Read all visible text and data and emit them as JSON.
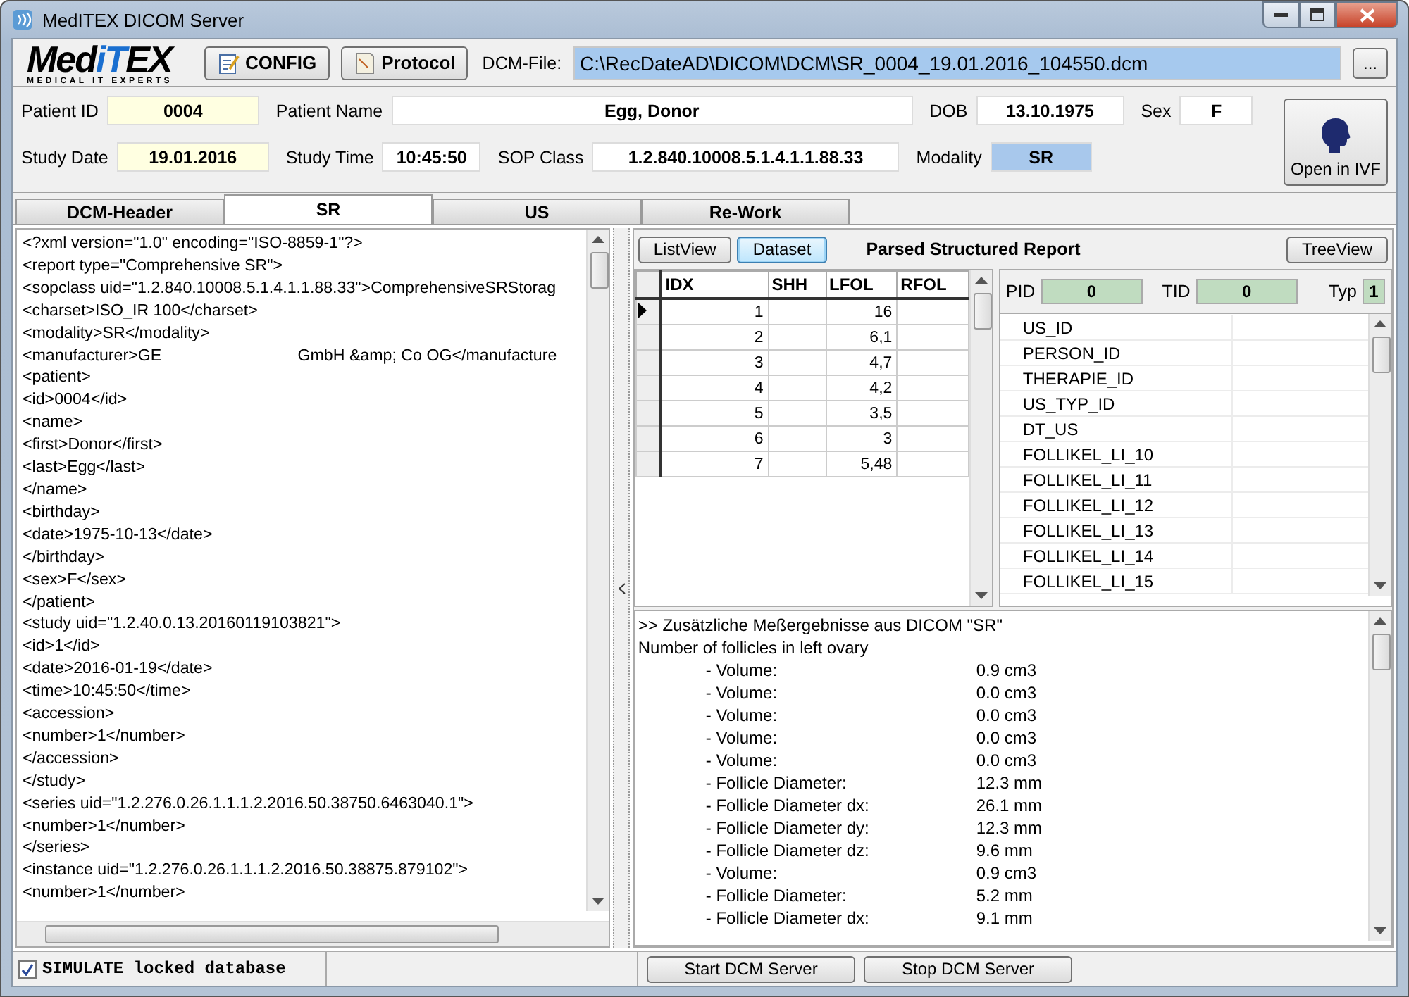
{
  "window": {
    "title": "MedITEX DICOM Server"
  },
  "logo": {
    "part_1": "Med",
    "part_2": "iT",
    "part_3": "EX",
    "tagline": "MEDICAL IT EXPERTS"
  },
  "toolbar": {
    "buttons": [
      "CONFIG",
      "Protocol"
    ],
    "file_label": "DCM-File:",
    "file_value": "C:\\RecDateAD\\DICOM\\DCM\\SR_0004_19.01.2016_104550.dcm",
    "browse": "..."
  },
  "patient": {
    "row_1": [
      {
        "label": "Patient ID",
        "value": "0004",
        "color": "#ffffe1"
      },
      {
        "label": "Patient Name",
        "value": "Egg, Donor",
        "color": "#ffffff"
      },
      {
        "label": "DOB",
        "value": "13.10.1975",
        "color": "#ffffff"
      },
      {
        "label": "Sex",
        "value": "F",
        "color": "#ffffff"
      }
    ],
    "row_2": [
      {
        "label": "Study Date",
        "value": "19.01.2016",
        "color": "#ffffe1"
      },
      {
        "label": "Study Time",
        "value": "10:45:50",
        "color": "#ffffff"
      },
      {
        "label": "SOP Class",
        "value": "1.2.840.10008.5.1.4.1.1.88.33",
        "color": "#ffffff"
      },
      {
        "label": "Modality",
        "value": "SR",
        "color": "#a8c8ec"
      }
    ],
    "open_button": "Open in IVF"
  },
  "tabs": [
    {
      "label": "DCM-Header",
      "selected": false
    },
    {
      "label": "SR",
      "selected": true
    },
    {
      "label": "US",
      "selected": false
    },
    {
      "label": "Re-Work",
      "selected": false
    }
  ],
  "xml_lines": [
    "<?xml version=\"1.0\" encoding=\"ISO-8859-1\"?>",
    "<report type=\"Comprehensive SR\">",
    "<sopclass uid=\"1.2.840.10008.5.1.4.1.1.88.33\">ComprehensiveSRStorag",
    "<charset>ISO_IR 100</charset>",
    "<modality>SR</modality>",
    "<manufacturer>GE                              GmbH &amp; Co OG</manufacture",
    "<patient>",
    "<id>0004</id>",
    "<name>",
    "<first>Donor</first>",
    "<last>Egg</last>",
    "</name>",
    "<birthday>",
    "<date>1975-10-13</date>",
    "</birthday>",
    "<sex>F</sex>",
    "</patient>",
    "<study uid=\"1.2.40.0.13.20160119103821\">",
    "<id>1</id>",
    "<date>2016-01-19</date>",
    "<time>10:45:50</time>",
    "<accession>",
    "<number>1</number>",
    "</accession>",
    "</study>",
    "<series uid=\"1.2.276.0.26.1.1.1.2.2016.50.38750.6463040.1\">",
    "<number>1</number>",
    "</series>",
    "<instance uid=\"1.2.276.0.26.1.1.1.2.2016.50.38875.879102\">",
    "<number>1</number>"
  ],
  "sr_toolbar": {
    "buttons": [
      {
        "label": "ListView",
        "selected": false
      },
      {
        "label": "Dataset",
        "selected": true
      }
    ],
    "title": "Parsed Structured Report",
    "tree_button": "TreeView"
  },
  "grid": {
    "columns": [
      "IDX",
      "SHH",
      "LFOL",
      "RFOL"
    ],
    "rows": [
      {
        "cells": [
          "1",
          "",
          "16",
          ""
        ],
        "current": true
      },
      {
        "cells": [
          "2",
          "",
          "6,1",
          ""
        ],
        "current": false
      },
      {
        "cells": [
          "3",
          "",
          "4,7",
          ""
        ],
        "current": false
      },
      {
        "cells": [
          "4",
          "",
          "4,2",
          ""
        ],
        "current": false
      },
      {
        "cells": [
          "5",
          "",
          "3,5",
          ""
        ],
        "current": false
      },
      {
        "cells": [
          "6",
          "",
          "3",
          ""
        ],
        "current": false
      },
      {
        "cells": [
          "7",
          "",
          "5,48",
          ""
        ],
        "current": false
      }
    ]
  },
  "ids": [
    {
      "label": "PID",
      "value": "0"
    },
    {
      "label": "TID",
      "value": "0"
    },
    {
      "label": "Typ",
      "value": "1"
    }
  ],
  "field_list": [
    "US_ID",
    "PERSON_ID",
    "THERAPIE_ID",
    "US_TYP_ID",
    "DT_US",
    "FOLLIKEL_LI_10",
    "FOLLIKEL_LI_11",
    "FOLLIKEL_LI_12",
    "FOLLIKEL_LI_13",
    "FOLLIKEL_LI_14",
    "FOLLIKEL_LI_15"
  ],
  "report": {
    "heading": ">> Zusätzliche Meßergebnisse aus DICOM \"SR\"",
    "subheading": "Number of follicles in left ovary",
    "lines": [
      {
        "label": "- Volume:",
        "value": "0.9 cm3"
      },
      {
        "label": "- Volume:",
        "value": "0.0 cm3"
      },
      {
        "label": "- Volume:",
        "value": "0.0 cm3"
      },
      {
        "label": "- Volume:",
        "value": "0.0 cm3"
      },
      {
        "label": "- Volume:",
        "value": "0.0 cm3"
      },
      {
        "label": "- Follicle Diameter:",
        "value": "12.3 mm"
      },
      {
        "label": "- Follicle Diameter dx:",
        "value": "26.1 mm"
      },
      {
        "label": "- Follicle Diameter dy:",
        "value": "12.3 mm"
      },
      {
        "label": "- Follicle Diameter dz:",
        "value": "9.6 mm"
      },
      {
        "label": "- Volume:",
        "value": "0.9 cm3"
      },
      {
        "label": "- Follicle Diameter:",
        "value": "5.2 mm"
      },
      {
        "label": "- Follicle Diameter dx:",
        "value": "9.1 mm"
      }
    ]
  },
  "status_bar": {
    "simulate": {
      "label": "SIMULATE locked database",
      "checked": true
    },
    "buttons": [
      "Start DCM Server",
      "Stop DCM Server"
    ]
  }
}
